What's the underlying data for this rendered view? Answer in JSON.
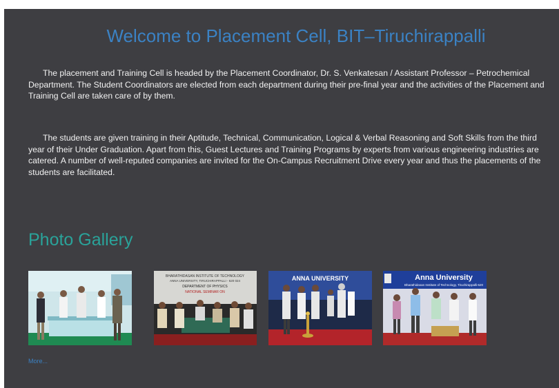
{
  "header": {
    "title": "Welcome to Placement Cell, BIT–Tiruchirappalli"
  },
  "intro": {
    "paragraph1": "The placement and Training Cell is headed by the Placement Coordinator, Dr. S. Venkatesan / Assistant Professor – Petrochemical Department. The Student Coordinators are elected from each department during their pre-final year and the activities of the Placement and Training Cell are taken care of by them.",
    "paragraph2": "The students are given training in their Aptitude, Technical, Communication, Logical & Verbal Reasoning and Soft Skills from the third year of their Under Graduation. Apart from this, Guest Lectures and Training Programs by experts from various engineering industries are catered. A number of well-reputed companies are invited for the On-Campus Recruitment Drive every year and thus the placements of the students are facilitated."
  },
  "gallery": {
    "title": "Photo Gallery",
    "photo2_banner": [
      "BHARATHIDASAN INSTITUTE OF TECHNOLOGY",
      "ANNA UNIVERSITY, TIRUCHIRAPPALLI - 620 024",
      "DEPARTMENT OF PHYSICS",
      "NATIONAL SEMINAR ON"
    ],
    "photo3_banner": "ANNA UNIVERSITY",
    "photo4_banner": "Anna University",
    "photo4_subbanner": "Bharathidasan Institute of Technology, Tiruchirappalli-620",
    "more_link": "More..."
  },
  "colors": {
    "panel": "#3e3e42",
    "title": "#3b82c4",
    "gallery_title": "#2aa39a",
    "text": "#f2f2f2"
  }
}
